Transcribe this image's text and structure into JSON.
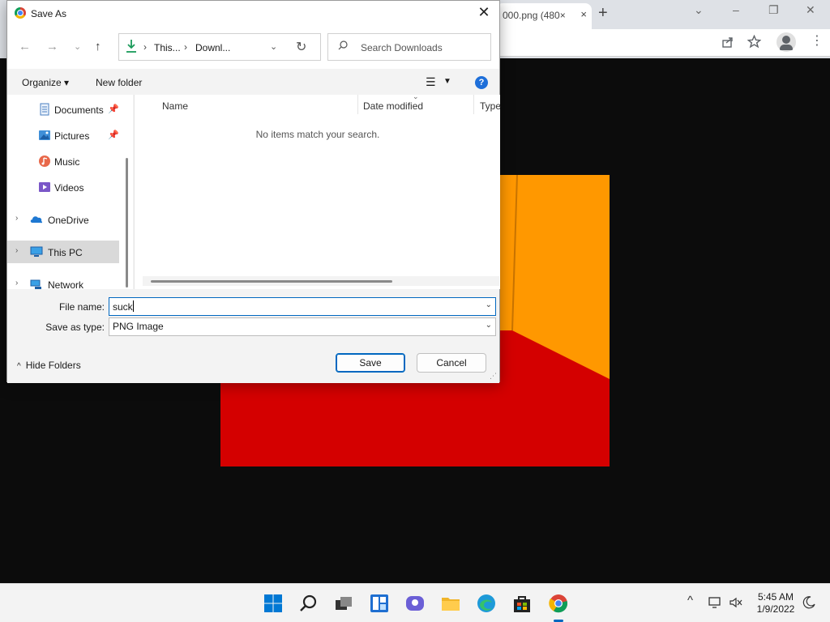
{
  "browser": {
    "tab_title": "000.png (480×",
    "tab_close": "×",
    "new_tab": "+",
    "window_controls": {
      "tabs_menu": "⌄",
      "minimize": "–",
      "restore": "❐",
      "close": "✕"
    },
    "toolbar_icons": [
      "share-icon",
      "star-icon",
      "profile-icon",
      "menu-icon"
    ]
  },
  "dialog": {
    "title": "Save As",
    "nav": {
      "back": "←",
      "forward": "→",
      "recent": "⌄",
      "up": "↑"
    },
    "address": {
      "crumbs": [
        "This...",
        "Downl..."
      ],
      "separator": "›"
    },
    "search": {
      "placeholder": "Search Downloads"
    },
    "commands": {
      "organize": "Organize ▾",
      "new_folder": "New folder",
      "help": "?"
    },
    "sidebar": {
      "items": [
        {
          "label": "Documents",
          "icon": "documents-icon",
          "pinned": true,
          "expander": false
        },
        {
          "label": "Pictures",
          "icon": "pictures-icon",
          "pinned": true,
          "expander": false
        },
        {
          "label": "Music",
          "icon": "music-icon",
          "pinned": false,
          "expander": false
        },
        {
          "label": "Videos",
          "icon": "videos-icon",
          "pinned": false,
          "expander": false
        },
        {
          "label": "OneDrive",
          "icon": "onedrive-icon",
          "pinned": false,
          "expander": true
        },
        {
          "label": "This PC",
          "icon": "this-pc-icon",
          "pinned": false,
          "expander": true,
          "selected": true
        },
        {
          "label": "Network",
          "icon": "network-icon",
          "pinned": false,
          "expander": true
        }
      ]
    },
    "file_list": {
      "columns": [
        "Name",
        "Date modified",
        "Type"
      ],
      "empty_message": "No items match your search."
    },
    "form": {
      "file_name_label": "File name:",
      "file_name_value": "suck",
      "type_label": "Save as type:",
      "type_value": "PNG Image"
    },
    "footer": {
      "hide_folders": "Hide Folders",
      "save": "Save",
      "cancel": "Cancel"
    }
  },
  "taskbar": {
    "apps": [
      "windows-start-icon",
      "search-icon",
      "task-view-icon",
      "widgets-icon",
      "chat-icon",
      "file-explorer-icon",
      "edge-icon",
      "store-icon",
      "chrome-icon"
    ],
    "tray": {
      "overflow": "^"
    },
    "time": "5:45 AM",
    "date": "1/9/2022"
  },
  "colors": {
    "accent": "#0067c0",
    "image_red": "#d40000",
    "image_orange": "#ff9800"
  }
}
